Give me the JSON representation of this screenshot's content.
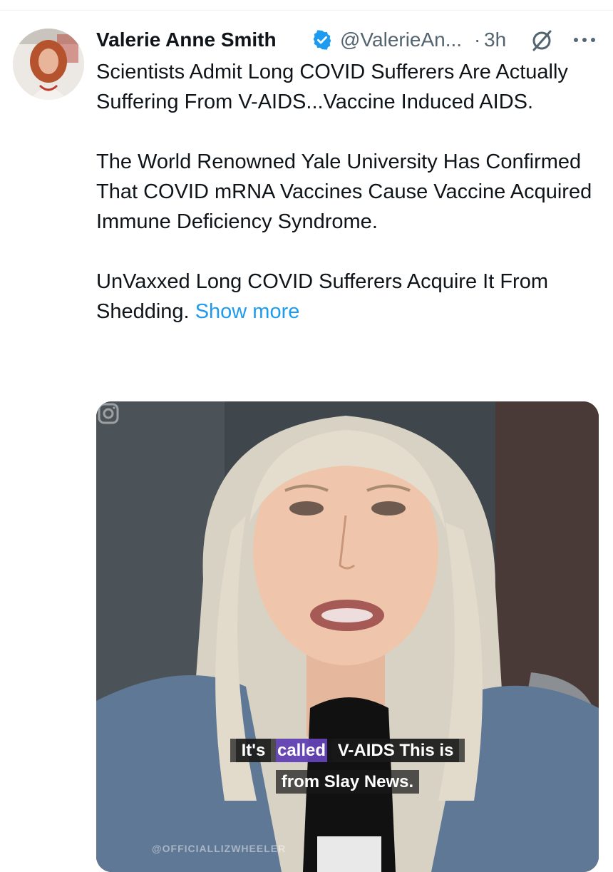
{
  "tweet": {
    "author": {
      "name": "Valerie Anne Smith",
      "handle": "@ValerieAn...",
      "separator": "·",
      "time": "3h",
      "verified": true
    },
    "icons": {
      "verified": "verified-badge-icon",
      "grok": "grok-icon",
      "more": "more-options-icon",
      "instagram": "instagram-icon"
    },
    "text": {
      "paragraph_1": "Scientists Admit Long COVID Sufferers Are Actually Suffering From V-AIDS...Vaccine Induced AIDS.",
      "paragraph_2": "The World Renowned Yale University Has Confirmed That COVID mRNA Vaccines Cause Vaccine Acquired Immune Deficiency Syndrome.",
      "paragraph_3": "UnVaxxed Long COVID Sufferers Acquire It From Shedding.",
      "show_more": "Show more"
    },
    "media": {
      "caption_line1_pre": "It's",
      "caption_line1_highlight": "called",
      "caption_line1_post": "V-AIDS This is",
      "caption_line2": "from Slay News.",
      "watermark": "@OFFICIALLIZWHEELER"
    },
    "colors": {
      "link": "#1d9bf0",
      "verified": "#1d9bf0",
      "secondary_text": "#536471",
      "caption_highlight": "#6c48c8"
    }
  }
}
